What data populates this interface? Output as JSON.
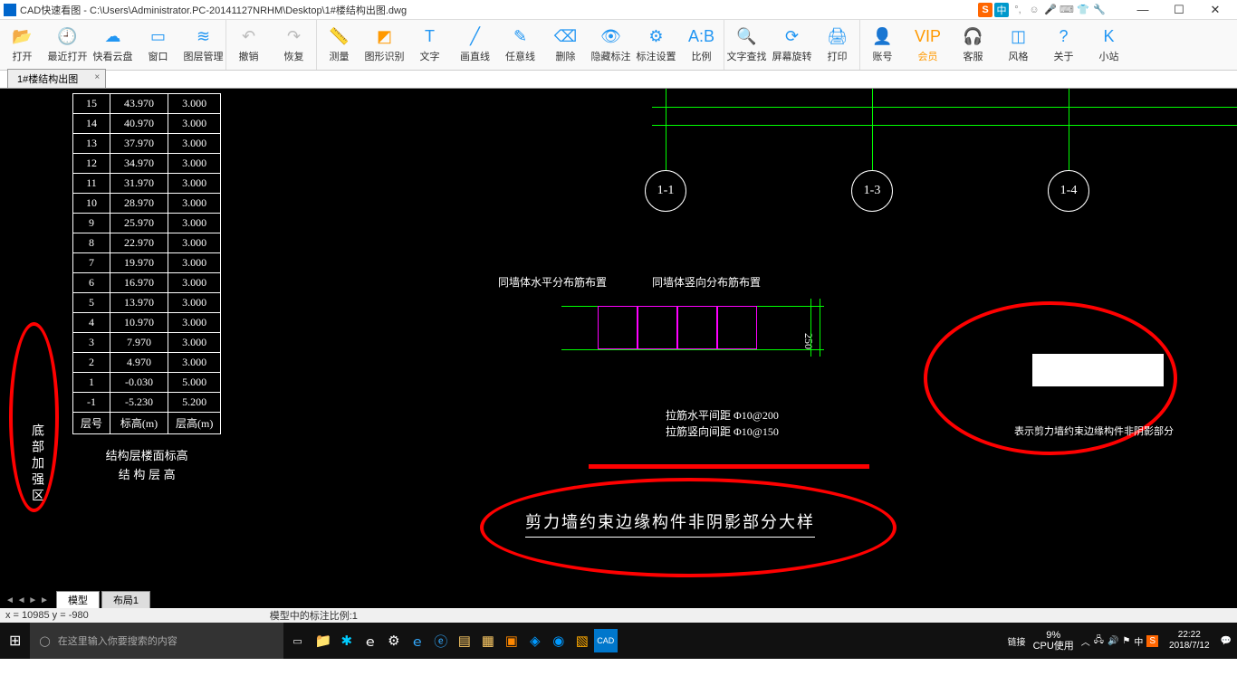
{
  "window": {
    "title": "CAD快速看图 - C:\\Users\\Administrator.PC-20141127NRHM\\Desktop\\1#楼结构出图.dwg",
    "min": "—",
    "max": "☐",
    "close": "✕"
  },
  "ime": {
    "s": "S",
    "cn": "中"
  },
  "toolbar": [
    {
      "id": "open",
      "label": "打开",
      "color": "#2196f3",
      "glyph": "📂"
    },
    {
      "id": "recent",
      "label": "最近打开",
      "color": "#2196f3",
      "glyph": "🕘"
    },
    {
      "id": "cloud",
      "label": "快看云盘",
      "color": "#2196f3",
      "glyph": "☁"
    },
    {
      "id": "window",
      "label": "窗口",
      "color": "#2196f3",
      "glyph": "▭"
    },
    {
      "id": "layer",
      "label": "图层管理",
      "color": "#2196f3",
      "glyph": "≋"
    },
    {
      "id": "undo",
      "label": "撤销",
      "color": "#bbb",
      "glyph": "↶"
    },
    {
      "id": "redo",
      "label": "恢复",
      "color": "#bbb",
      "glyph": "↷"
    },
    {
      "id": "measure",
      "label": "测量",
      "color": "#2196f3",
      "glyph": "📏"
    },
    {
      "id": "shape",
      "label": "图形识别",
      "color": "#ff9900",
      "glyph": "◩"
    },
    {
      "id": "text",
      "label": "文字",
      "color": "#2196f3",
      "glyph": "T"
    },
    {
      "id": "line",
      "label": "画直线",
      "color": "#2196f3",
      "glyph": "╱"
    },
    {
      "id": "anyline",
      "label": "任意线",
      "color": "#2196f3",
      "glyph": "✎"
    },
    {
      "id": "delete",
      "label": "删除",
      "color": "#2196f3",
      "glyph": "⌫"
    },
    {
      "id": "hide",
      "label": "隐藏标注",
      "color": "#2196f3",
      "glyph": "👁"
    },
    {
      "id": "annoset",
      "label": "标注设置",
      "color": "#2196f3",
      "glyph": "⚙"
    },
    {
      "id": "scale",
      "label": "比例",
      "color": "#2196f3",
      "glyph": "A:B"
    },
    {
      "id": "findtext",
      "label": "文字查找",
      "color": "#2196f3",
      "glyph": "🔍"
    },
    {
      "id": "rotate",
      "label": "屏幕旋转",
      "color": "#2196f3",
      "glyph": "⟳"
    },
    {
      "id": "print",
      "label": "打印",
      "color": "#2196f3",
      "glyph": "🖨"
    },
    {
      "id": "account",
      "label": "账号",
      "color": "#2196f3",
      "glyph": "👤"
    },
    {
      "id": "vip",
      "label": "会员",
      "color": "#ff9900",
      "glyph": "VIP"
    },
    {
      "id": "support",
      "label": "客服",
      "color": "#2196f3",
      "glyph": "🎧"
    },
    {
      "id": "style",
      "label": "风格",
      "color": "#2196f3",
      "glyph": "◫"
    },
    {
      "id": "about",
      "label": "关于",
      "color": "#2196f3",
      "glyph": "?"
    },
    {
      "id": "site",
      "label": "小站",
      "color": "#2196f3",
      "glyph": "K"
    }
  ],
  "filetab": {
    "name": "1#楼结构出图",
    "close": "×"
  },
  "floor_table": {
    "rows": [
      [
        "15",
        "43.970",
        "3.000"
      ],
      [
        "14",
        "40.970",
        "3.000"
      ],
      [
        "13",
        "37.970",
        "3.000"
      ],
      [
        "12",
        "34.970",
        "3.000"
      ],
      [
        "11",
        "31.970",
        "3.000"
      ],
      [
        "10",
        "28.970",
        "3.000"
      ],
      [
        "9",
        "25.970",
        "3.000"
      ],
      [
        "8",
        "22.970",
        "3.000"
      ],
      [
        "7",
        "19.970",
        "3.000"
      ],
      [
        "6",
        "16.970",
        "3.000"
      ],
      [
        "5",
        "13.970",
        "3.000"
      ],
      [
        "4",
        "10.970",
        "3.000"
      ],
      [
        "3",
        "7.970",
        "3.000"
      ],
      [
        "2",
        "4.970",
        "3.000"
      ],
      [
        "1",
        "-0.030",
        "5.000"
      ],
      [
        "-1",
        "-5.230",
        "5.200"
      ],
      [
        "层号",
        "标高(m)",
        "层高(m)"
      ]
    ],
    "caption1": "结构层楼面标高",
    "caption2": "结 构 层 高"
  },
  "vertical_label": "底部加强区",
  "grid_marks": {
    "g1": "1-1",
    "g2": "1-3",
    "g3": "1-4"
  },
  "diagram": {
    "label_left": "同墙体水平分布筋布置",
    "label_right": "同墙体竖向分布筋布置",
    "dim_v": "250",
    "spec1": "拉筋水平间距 Φ10@200",
    "spec2": "拉筋竖向间距 Φ10@150",
    "right_caption": "表示剪力墙约束边缘构件非阴影部分"
  },
  "main_title": "剪力墙约束边缘构件非阴影部分大样",
  "bottom_tabs": {
    "model": "模型",
    "layout1": "布局1"
  },
  "status": {
    "coords": "x = 10985  y = -980",
    "scale": "模型中的标注比例:1"
  },
  "taskbar": {
    "search_ph": "在这里输入你要搜索的内容",
    "link": "链接",
    "cpu1": "9%",
    "cpu2": "CPU使用",
    "time": "22:22",
    "date": "2018/7/12",
    "ime_cn": "中"
  }
}
